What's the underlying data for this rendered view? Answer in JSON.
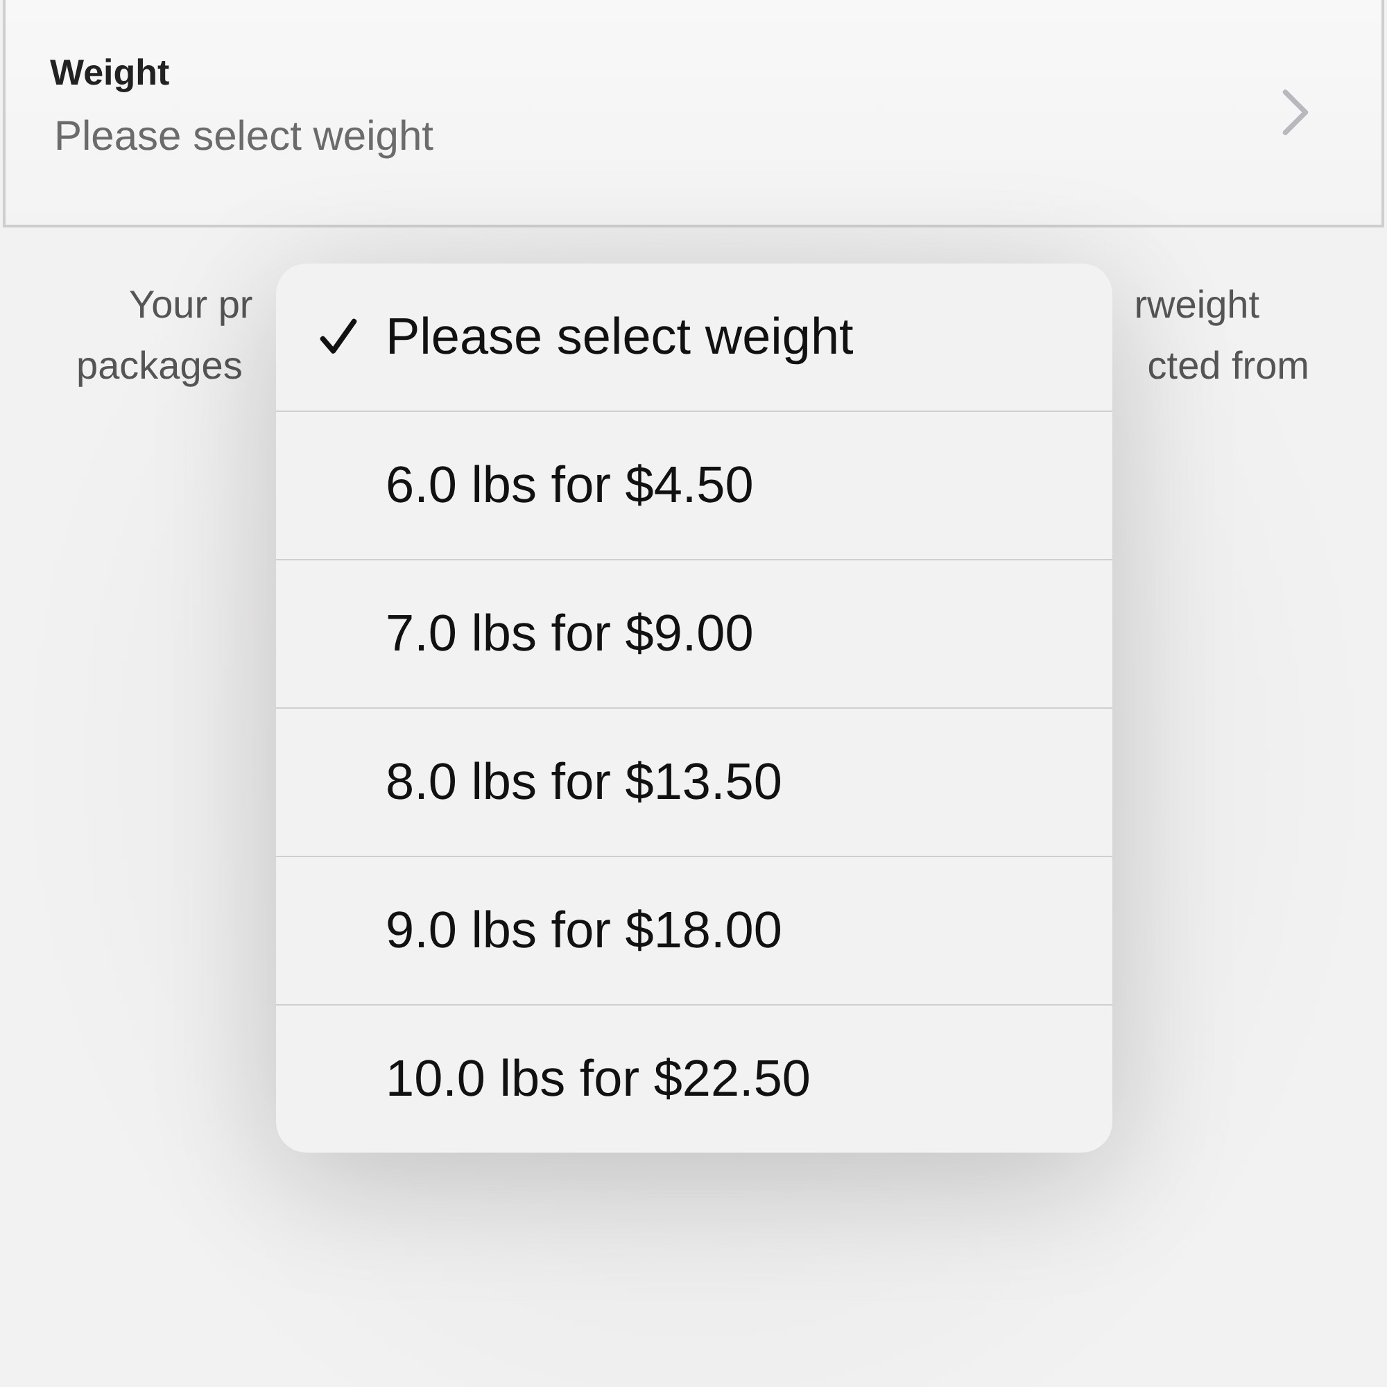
{
  "field": {
    "label": "Weight",
    "value": "Please select weight"
  },
  "note_fragments": {
    "line_1": {
      "left": "Your pr",
      "right": "rweight"
    },
    "line_2": {
      "left": "packages",
      "right": "cted from"
    }
  },
  "menu": {
    "options": [
      {
        "label": "Please select weight",
        "selected": true
      },
      {
        "label": "6.0 lbs for $4.50",
        "selected": false
      },
      {
        "label": "7.0 lbs for $9.00",
        "selected": false
      },
      {
        "label": "8.0 lbs for $13.50",
        "selected": false
      },
      {
        "label": "9.0 lbs for $18.00",
        "selected": false
      },
      {
        "label": "10.0 lbs for $22.50",
        "selected": false
      }
    ]
  }
}
